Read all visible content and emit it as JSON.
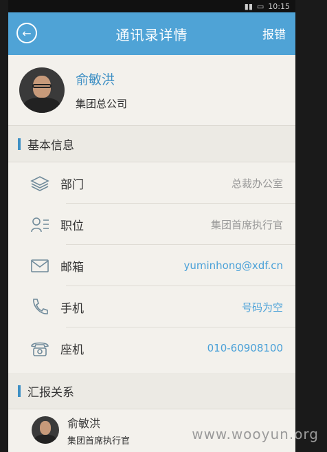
{
  "statusbar": {
    "time": "10:15"
  },
  "header": {
    "title": "通讯录详情",
    "report_label": "报错"
  },
  "profile": {
    "name": "俞敏洪",
    "org": "集团总公司"
  },
  "basic_section": {
    "title": "基本信息"
  },
  "fields": {
    "department": {
      "label": "部门",
      "value": "总裁办公室"
    },
    "position": {
      "label": "职位",
      "value": "集团首席执行官"
    },
    "email": {
      "label": "邮箱",
      "value": "yuminhong@xdf.cn"
    },
    "mobile": {
      "label": "手机",
      "value": "号码为空"
    },
    "landline": {
      "label": "座机",
      "value": "010-60908100"
    }
  },
  "report_section": {
    "title": "汇报关系"
  },
  "report_contact": {
    "name": "俞敏洪",
    "role": "集团首席执行官"
  },
  "watermark": "www.wooyun.org",
  "colors": {
    "header": "#4fa3d6",
    "accent": "#3d8fc4"
  }
}
